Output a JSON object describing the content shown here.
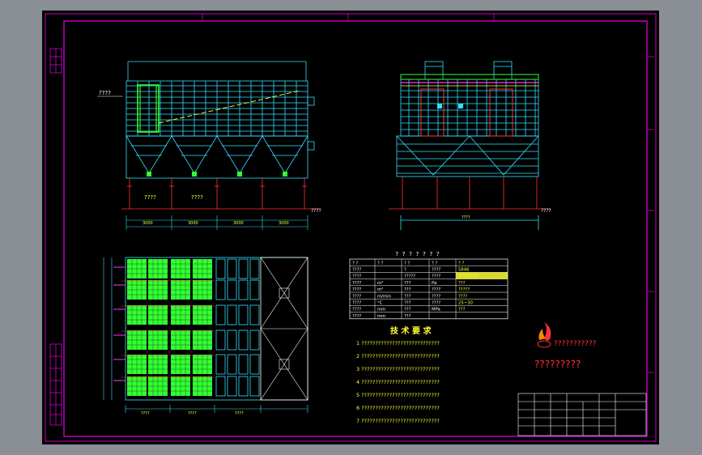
{
  "drawing": {
    "elev_height_label": "????",
    "front_floor_labels": [
      "????",
      "????"
    ],
    "side_floor_labels": [
      "????"
    ],
    "front_dim_labels": [
      "3000",
      "3000",
      "3000",
      "3000"
    ],
    "side_dim_labels": [
      "????"
    ],
    "front_bottom_notes": [
      "????",
      "????"
    ],
    "plan_dim_labels": [
      "????",
      "????",
      "????"
    ]
  },
  "param_table": {
    "title": "? ? ? ? ? ? ?",
    "rows": [
      [
        "? ?",
        "? ?",
        "? ?",
        "? ?",
        "? ?"
      ],
      [
        "????",
        "",
        "?",
        "????",
        "5846"
      ],
      [
        "????",
        "",
        "?????",
        "????",
        "?????????"
      ],
      [
        "????",
        "m³",
        "???",
        "Pa",
        "???"
      ],
      [
        "????",
        "m²",
        "???",
        "????",
        "?????"
      ],
      [
        "????",
        "m/min",
        "???",
        "????",
        "????"
      ],
      [
        "????",
        "°C",
        "???",
        "????",
        "25~30"
      ],
      [
        "????",
        "mm",
        "???",
        "MPa",
        "???"
      ],
      [
        "????",
        "mm",
        "???",
        "",
        ""
      ]
    ]
  },
  "tech_notes": {
    "heading": "技 术 要 求",
    "lines": [
      "1 ????????????????????????????",
      "2 ????????????????????????????",
      "3 ????????????????????????????",
      "4 ????????????????????????????",
      "5 ????????????????????????????",
      "6 ????????????????????????????",
      "7 ????????????????????????????"
    ]
  },
  "logo": {
    "text_line1": "???????????",
    "text_line2": "?????????"
  },
  "colors": {
    "background": "#000000",
    "border": "#cc00cc",
    "cyan": "#33e0ff",
    "green": "#33ff33",
    "yellow": "#ffff33",
    "red": "#ff3333",
    "magenta": "#ff33ff",
    "white": "#ffffff"
  }
}
